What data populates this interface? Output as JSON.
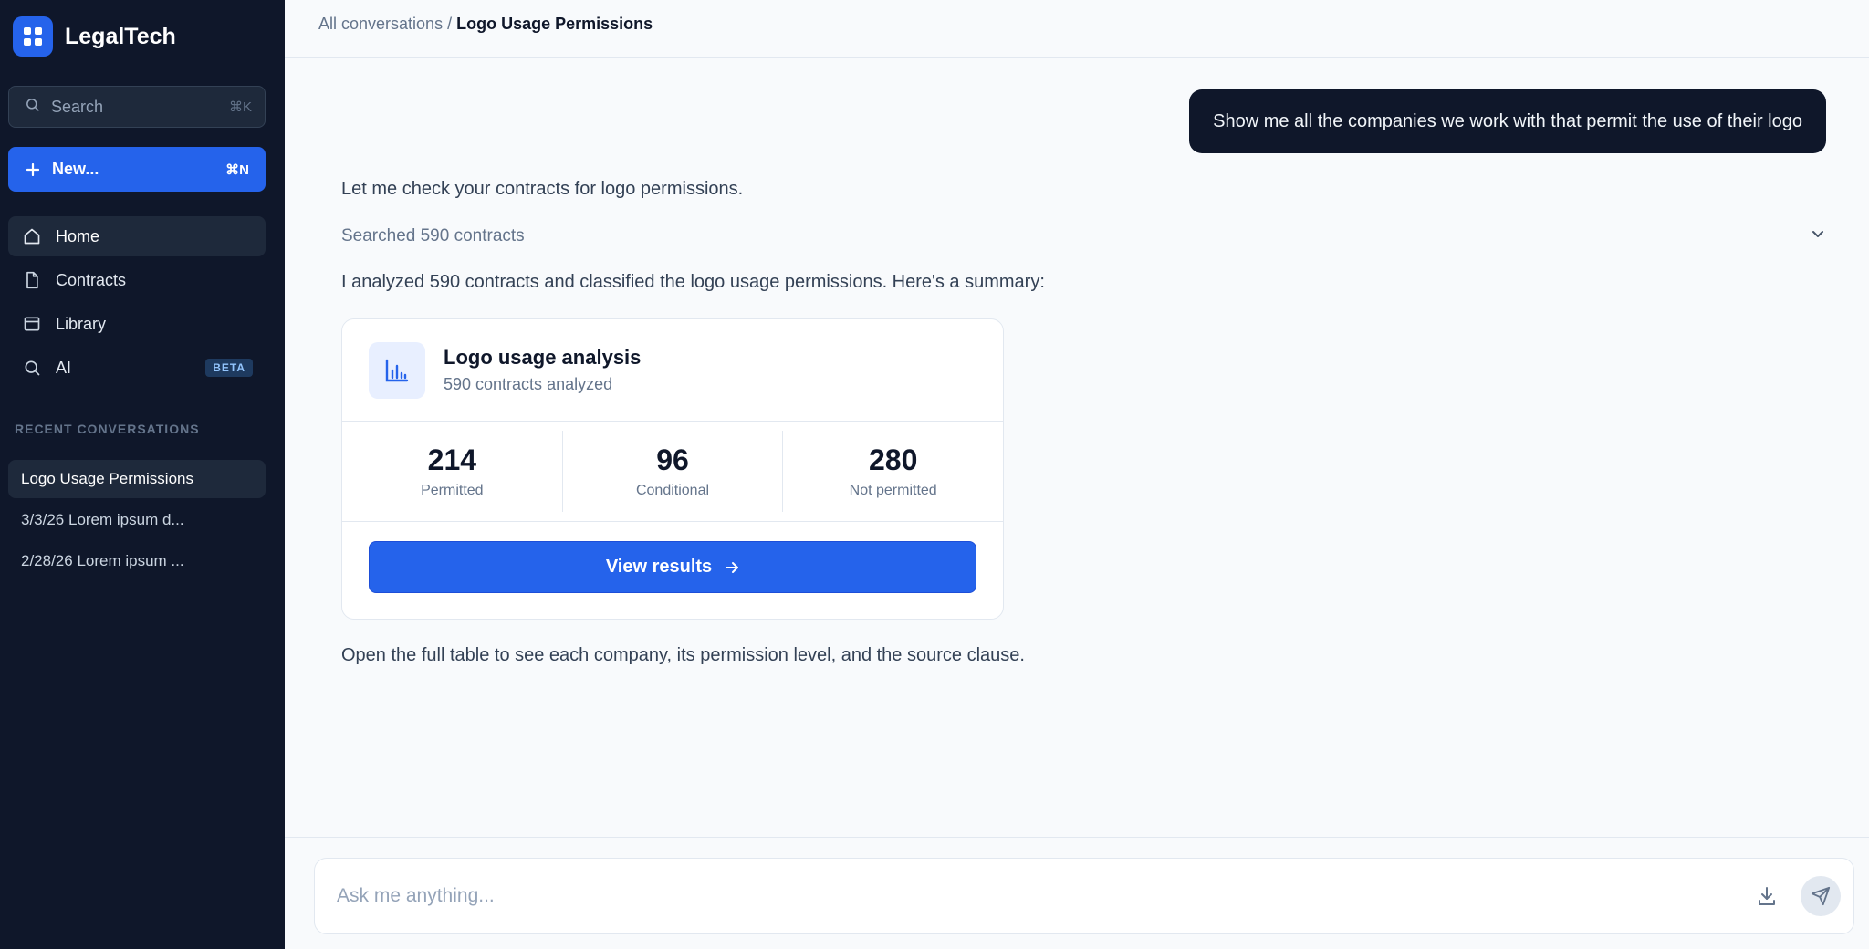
{
  "app": {
    "name": "LegalTech"
  },
  "sidebar": {
    "search": {
      "label": "Search",
      "shortcut": "⌘K"
    },
    "new_button": {
      "label": "New...",
      "shortcut": "⌘N"
    },
    "nav": [
      {
        "label": "Home",
        "icon": "home-icon",
        "active": true
      },
      {
        "label": "Contracts",
        "icon": "document-icon"
      },
      {
        "label": "Library",
        "icon": "library-icon"
      },
      {
        "label": "AI",
        "icon": "search-icon",
        "badge": "BETA"
      }
    ],
    "recent_title": "RECENT CONVERSATIONS",
    "recent": [
      {
        "label": "Logo Usage Permissions",
        "active": true
      },
      {
        "label": "3/3/26 Lorem ipsum d..."
      },
      {
        "label": "2/28/26 Lorem ipsum ..."
      }
    ]
  },
  "breadcrumb": {
    "parent": "All conversations",
    "separator": "/",
    "current": "Logo Usage Permissions"
  },
  "conversation": {
    "user_message": "Show me all the companies we work with that permit the use of their logo",
    "assistant_intro": "Let me check your contracts for logo permissions.",
    "searched_label": "Searched 590 contracts",
    "assistant_summary": "I analyzed 590 contracts and classified the logo usage permissions. Here's a summary:",
    "card": {
      "icon": "bar-chart-icon",
      "title": "Logo usage analysis",
      "subtitle": "590 contracts analyzed",
      "stats": [
        {
          "value": "214",
          "label": "Permitted"
        },
        {
          "value": "96",
          "label": "Conditional"
        },
        {
          "value": "280",
          "label": "Not permitted"
        }
      ],
      "button_label": "View results"
    },
    "assistant_outro": "Open the full table to see each company, its permission level, and the source clause."
  },
  "composer": {
    "placeholder": "Ask me anything..."
  },
  "colors": {
    "accent": "#2563eb",
    "sidebar_bg": "#0f172a",
    "user_bubble": "#0f172a"
  }
}
